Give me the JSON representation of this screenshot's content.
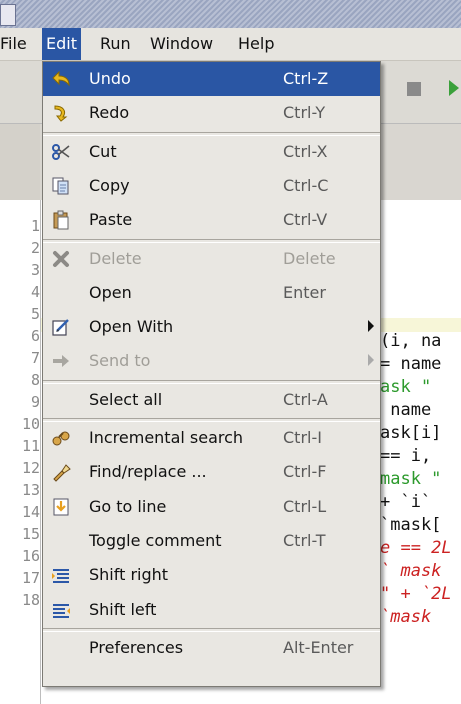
{
  "menubar": {
    "items": [
      {
        "label": "File",
        "active": false
      },
      {
        "label": "Edit",
        "active": true
      },
      {
        "label": "Run",
        "active": false
      },
      {
        "label": "Window",
        "active": false
      },
      {
        "label": "Help",
        "active": false
      }
    ]
  },
  "editor": {
    "line_numbers": [
      "1",
      "2",
      "3",
      "4",
      "5",
      "6",
      "7",
      "8",
      "9",
      "10",
      "11",
      "12",
      "13",
      "14",
      "15",
      "16",
      "17",
      "18"
    ],
    "code_fragments": [
      {
        "text": "(i, na",
        "color": "default"
      },
      {
        "text": "= name",
        "color": "default"
      },
      {
        "text": "ask \"",
        "color": "green"
      },
      {
        "text": " name",
        "color": "default"
      },
      {
        "text": "ask[i]",
        "color": "default"
      },
      {
        "text": "== i,",
        "color": "default"
      },
      {
        "text": "mask \"",
        "color": "green"
      },
      {
        "text": "+ `i`",
        "color": "default"
      },
      {
        "text": "`mask[",
        "color": "default"
      },
      {
        "text": "e == 2L",
        "color": "red"
      },
      {
        "text": "` mask",
        "color": "red"
      },
      {
        "text": "\" + `2L",
        "color": "red"
      },
      {
        "text": "`mask",
        "color": "red"
      }
    ]
  },
  "edit_menu": {
    "items": [
      {
        "type": "item",
        "label": "Undo",
        "shortcut": "Ctrl-Z",
        "icon": "undo-icon",
        "highlighted": true,
        "disabled": false
      },
      {
        "type": "item",
        "label": "Redo",
        "shortcut": "Ctrl-Y",
        "icon": "redo-icon",
        "highlighted": false,
        "disabled": false
      },
      {
        "type": "separator"
      },
      {
        "type": "item",
        "label": "Cut",
        "shortcut": "Ctrl-X",
        "icon": "scissors-icon",
        "highlighted": false,
        "disabled": false
      },
      {
        "type": "item",
        "label": "Copy",
        "shortcut": "Ctrl-C",
        "icon": "copy-icon",
        "highlighted": false,
        "disabled": false
      },
      {
        "type": "item",
        "label": "Paste",
        "shortcut": "Ctrl-V",
        "icon": "paste-icon",
        "highlighted": false,
        "disabled": false
      },
      {
        "type": "separator"
      },
      {
        "type": "item",
        "label": "Delete",
        "shortcut": "Delete",
        "icon": "delete-x-icon",
        "highlighted": false,
        "disabled": true
      },
      {
        "type": "item",
        "label": "Open",
        "shortcut": "Enter",
        "icon": "",
        "highlighted": false,
        "disabled": false
      },
      {
        "type": "item",
        "label": "Open With",
        "shortcut": "",
        "icon": "open-with-icon",
        "highlighted": false,
        "disabled": false,
        "submenu": true
      },
      {
        "type": "item",
        "label": "Send to",
        "shortcut": "",
        "icon": "send-arrow-icon",
        "highlighted": false,
        "disabled": true,
        "submenu": true
      },
      {
        "type": "separator"
      },
      {
        "type": "item",
        "label": "Select all",
        "shortcut": "Ctrl-A",
        "icon": "",
        "highlighted": false,
        "disabled": false
      },
      {
        "type": "separator"
      },
      {
        "type": "item",
        "label": "Incremental search",
        "shortcut": "Ctrl-I",
        "icon": "binoculars-icon",
        "highlighted": false,
        "disabled": false
      },
      {
        "type": "item",
        "label": "Find/replace ...",
        "shortcut": "Ctrl-F",
        "icon": "flashlight-icon",
        "highlighted": false,
        "disabled": false
      },
      {
        "type": "item",
        "label": "Go to line",
        "shortcut": "Ctrl-L",
        "icon": "goto-line-icon",
        "highlighted": false,
        "disabled": false
      },
      {
        "type": "item",
        "label": "Toggle comment",
        "shortcut": "Ctrl-T",
        "icon": "",
        "highlighted": false,
        "disabled": false
      },
      {
        "type": "item",
        "label": "Shift right",
        "shortcut": "",
        "icon": "shift-right-icon",
        "highlighted": false,
        "disabled": false
      },
      {
        "type": "item",
        "label": "Shift left",
        "shortcut": "",
        "icon": "shift-left-icon",
        "highlighted": false,
        "disabled": false
      },
      {
        "type": "separator"
      },
      {
        "type": "item",
        "label": "Preferences",
        "shortcut": "Alt-Enter",
        "icon": "",
        "highlighted": false,
        "disabled": false
      }
    ]
  },
  "colors": {
    "highlight": "#2a56a4",
    "menu_bg": "#e9e7e2",
    "disabled_text": "#a09e98"
  }
}
